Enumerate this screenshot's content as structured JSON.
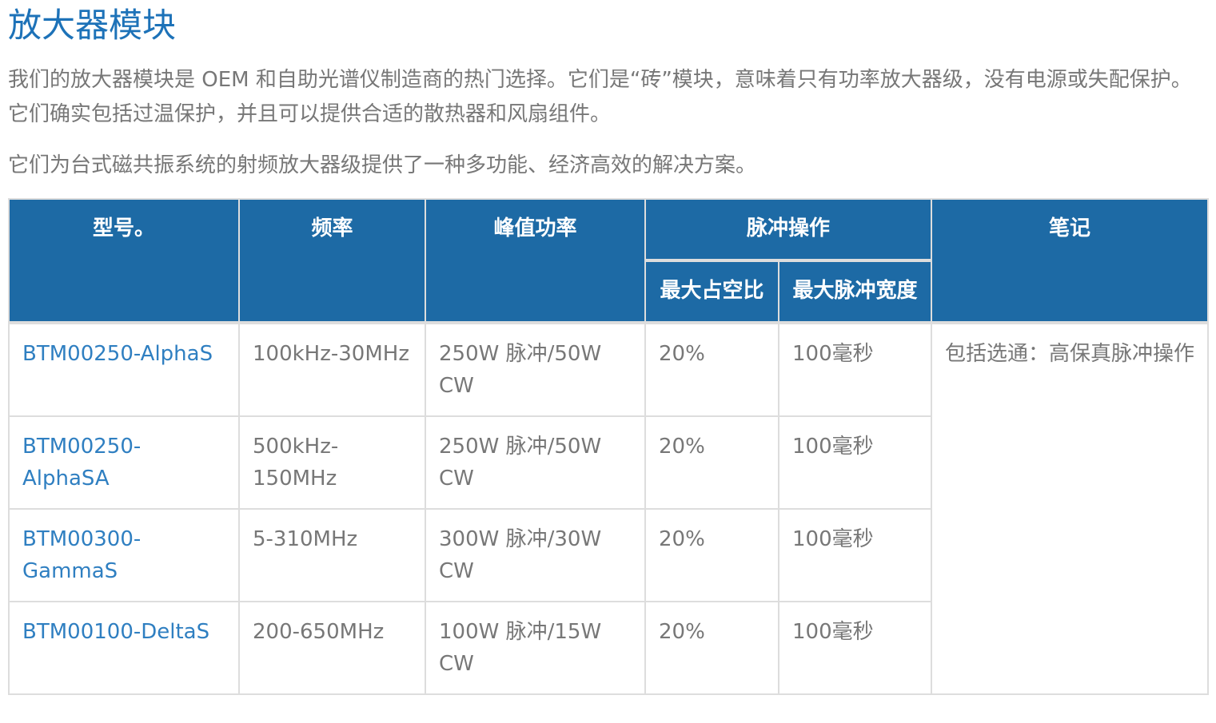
{
  "title": "放大器模块",
  "intro": "我们的放大器模块是 OEM 和自助光谱仪制造商的热门选择。它们是“砖”模块，意味着只有功率放大器级，没有电源或失配保护。它们确实包括过温保护，并且可以提供合适的散热器和风扇组件。",
  "intro2": "它们为台式磁共振系统的射频放大器级提供了一种多功能、经济高效的解决方案。",
  "table": {
    "headers": {
      "model": "型号。",
      "frequency": "频率",
      "peak_power": "峰值功率",
      "pulse_operation": "脉冲操作",
      "max_duty": "最大占空比",
      "max_pulse_width": "最大脉冲宽度",
      "notes": "笔记"
    },
    "rows": [
      {
        "model": "BTM00250-AlphaS",
        "frequency": "100kHz-30MHz",
        "peak_power": "250W 脉冲/50W CW",
        "max_duty": "20%",
        "max_pulse_width": "100毫秒"
      },
      {
        "model": "BTM00250-AlphaSA",
        "frequency": "500kHz-150MHz",
        "peak_power": "250W 脉冲/50W CW",
        "max_duty": "20%",
        "max_pulse_width": "100毫秒"
      },
      {
        "model": "BTM00300-GammaS",
        "frequency": "5-310MHz",
        "peak_power": "300W 脉冲/30W CW",
        "max_duty": "20%",
        "max_pulse_width": "100毫秒"
      },
      {
        "model": "BTM00100-DeltaS",
        "frequency": "200-650MHz",
        "peak_power": "100W 脉冲/15W CW",
        "max_duty": "20%",
        "max_pulse_width": "100毫秒"
      }
    ],
    "notes_text": "包括选通：高保真脉冲操作"
  }
}
